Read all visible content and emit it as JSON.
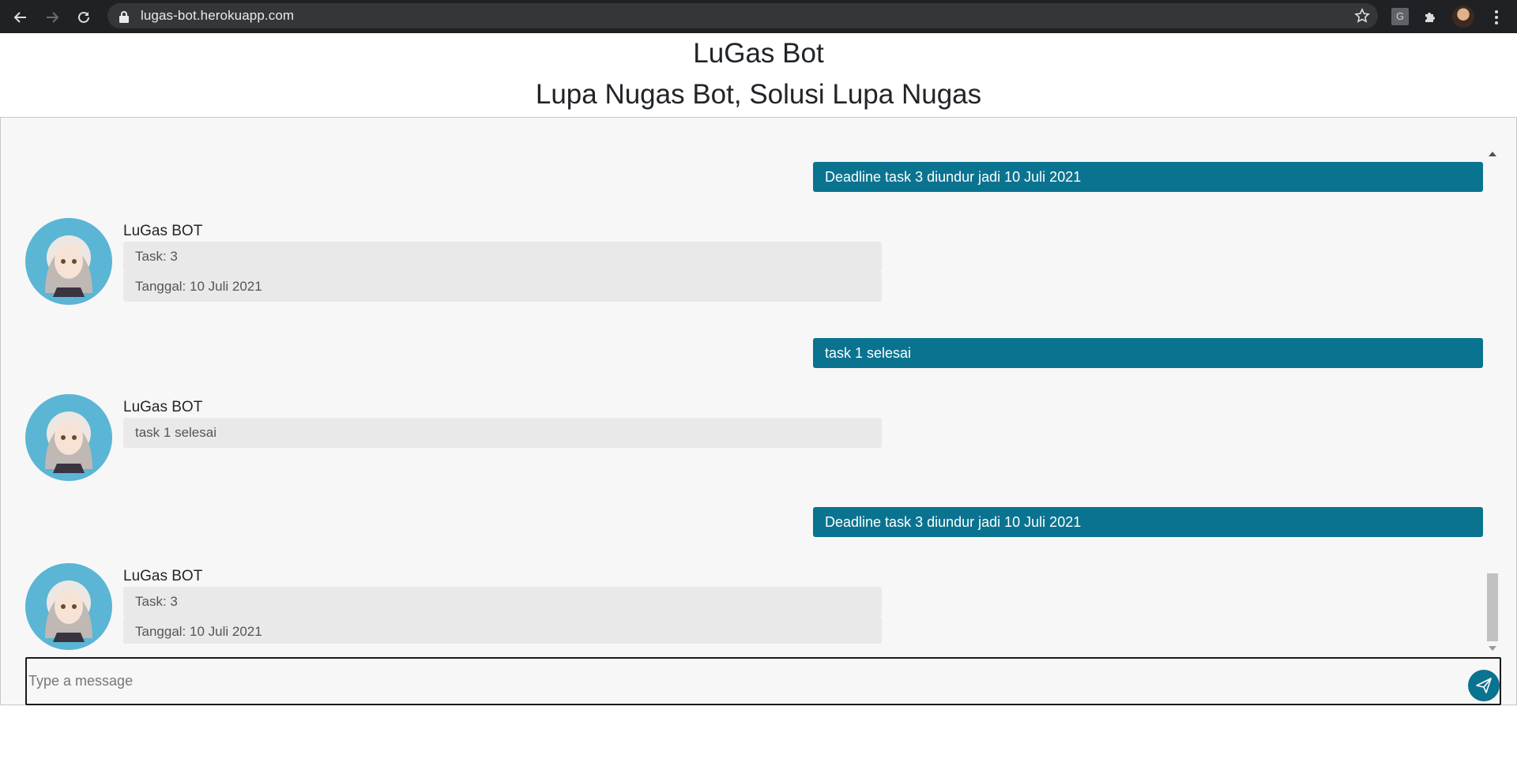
{
  "browser": {
    "url": "lugas-bot.herokuapp.com",
    "ext_g_label": "G"
  },
  "header": {
    "title": "LuGas Bot",
    "subtitle": "Lupa Nugas Bot, Solusi Lupa Nugas"
  },
  "chat": {
    "bot_name": "LuGas BOT",
    "messages": [
      {
        "sender": "user",
        "text": "Deadline task 3 diundur jadi 10 Juli 2021"
      },
      {
        "sender": "bot",
        "lines": [
          "Task: 3",
          "Tanggal: 10 Juli 2021"
        ]
      },
      {
        "sender": "user",
        "text": "task 1 selesai"
      },
      {
        "sender": "bot",
        "lines": [
          "task 1 selesai"
        ]
      },
      {
        "sender": "user",
        "text": "Deadline task 3 diundur jadi 10 Juli 2021"
      },
      {
        "sender": "bot",
        "lines": [
          "Task: 3",
          "Tanggal: 10 Juli 2021"
        ]
      }
    ]
  },
  "composer": {
    "placeholder": "Type a message",
    "value": ""
  },
  "colors": {
    "accent": "#0a7390",
    "avatar_bg": "#5bb5d5",
    "bot_bubble": "#e9e9e9",
    "chat_bg": "#f7f7f7"
  },
  "icons": {
    "back": "arrow-left-icon",
    "forward": "arrow-right-icon",
    "reload": "reload-icon",
    "lock": "lock-icon",
    "bookmark": "star-icon",
    "extensions": "puzzle-icon",
    "menu": "more-vert-icon",
    "send": "paper-plane-icon"
  }
}
